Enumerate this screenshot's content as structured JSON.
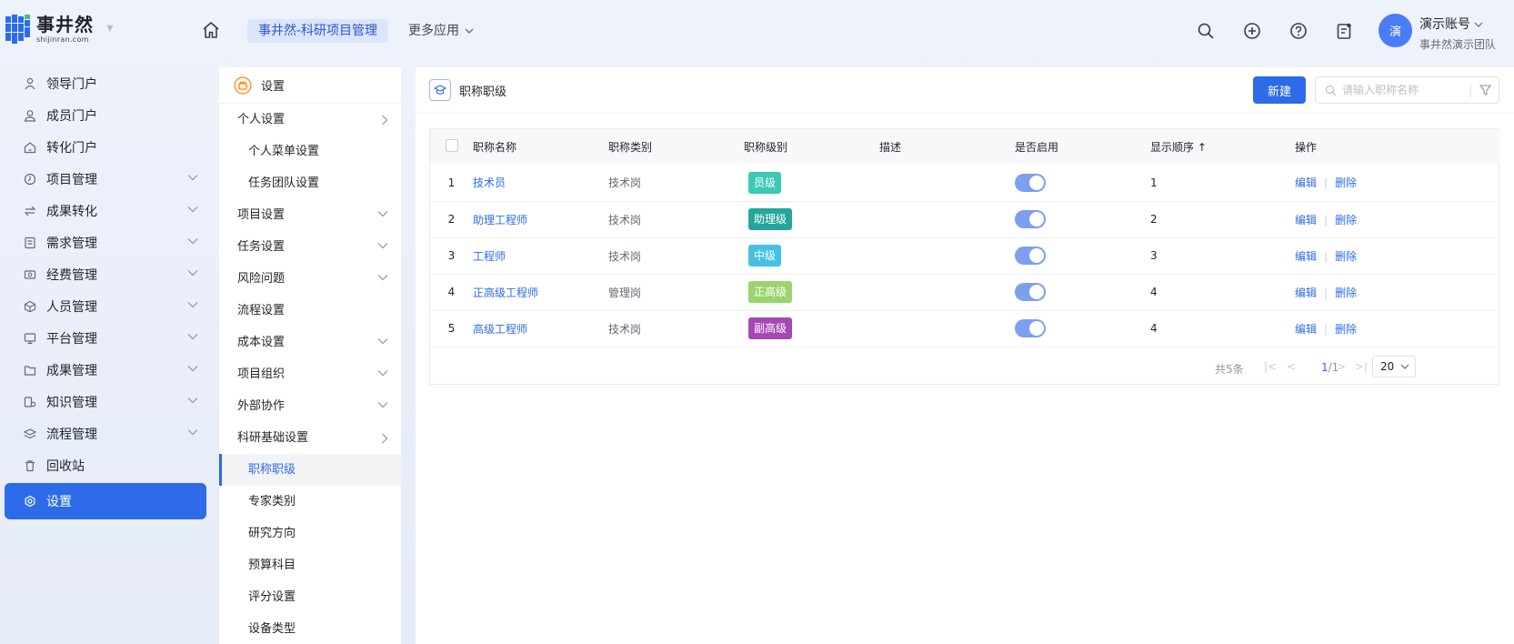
{
  "header": {
    "logo_cn": "事井然",
    "logo_en": "shijinran.com",
    "app_tab": "事井然-科研项目管理",
    "more_apps": "更多应用",
    "avatar_initial": "演",
    "account_name": "演示账号",
    "account_team": "事井然演示团队"
  },
  "leftnav": {
    "items": [
      {
        "label": "领导门户",
        "icon": "person-icon"
      },
      {
        "label": "成员门户",
        "icon": "user-icon"
      },
      {
        "label": "转化门户",
        "icon": "house-icon"
      },
      {
        "label": "项目管理",
        "icon": "clock-icon"
      },
      {
        "label": "成果转化",
        "icon": "transfer-icon"
      },
      {
        "label": "需求管理",
        "icon": "document-icon"
      },
      {
        "label": "经费管理",
        "icon": "money-icon"
      },
      {
        "label": "人员管理",
        "icon": "cube-icon"
      },
      {
        "label": "平台管理",
        "icon": "monitor-icon"
      },
      {
        "label": "成果管理",
        "icon": "folder-icon"
      },
      {
        "label": "知识管理",
        "icon": "knowledge-icon"
      },
      {
        "label": "流程管理",
        "icon": "layers-icon"
      },
      {
        "label": "回收站",
        "icon": "trash-icon"
      },
      {
        "label": "设置",
        "icon": "settings-icon"
      }
    ]
  },
  "subnav": {
    "title": "设置",
    "items": [
      {
        "label": "个人设置"
      },
      {
        "label": "个人菜单设置"
      },
      {
        "label": "任务团队设置"
      },
      {
        "label": "项目设置"
      },
      {
        "label": "任务设置"
      },
      {
        "label": "风险问题"
      },
      {
        "label": "流程设置"
      },
      {
        "label": "成本设置"
      },
      {
        "label": "项目组织"
      },
      {
        "label": "外部协作"
      },
      {
        "label": "科研基础设置"
      },
      {
        "label": "职称职级"
      },
      {
        "label": "专家类别"
      },
      {
        "label": "研究方向"
      },
      {
        "label": "预算科目"
      },
      {
        "label": "评分设置"
      },
      {
        "label": "设备类型"
      }
    ]
  },
  "main": {
    "title": "职称职级",
    "new_button": "新建",
    "search_placeholder": "请输入职称名称",
    "columns": {
      "name": "职称名称",
      "category": "职称类别",
      "level": "职称级别",
      "description": "描述",
      "enabled": "是否启用",
      "order": "显示顺序",
      "sort_arrow": "↑",
      "actions": "操作"
    },
    "rows": [
      {
        "index": "1",
        "name": "技术员",
        "category": "技术岗",
        "level": "员级",
        "level_color": "#3cc8b4",
        "enabled": true,
        "order": "1"
      },
      {
        "index": "2",
        "name": "助理工程师",
        "category": "技术岗",
        "level": "助理级",
        "level_color": "#26a69a",
        "enabled": true,
        "order": "2"
      },
      {
        "index": "3",
        "name": "工程师",
        "category": "技术岗",
        "level": "中级",
        "level_color": "#47c1e3",
        "enabled": true,
        "order": "3"
      },
      {
        "index": "4",
        "name": "正高级工程师",
        "category": "管理岗",
        "level": "正高级",
        "level_color": "#9bd46e",
        "enabled": true,
        "order": "4"
      },
      {
        "index": "5",
        "name": "高级工程师",
        "category": "技术岗",
        "level": "副高级",
        "level_color": "#a548b6",
        "enabled": true,
        "order": "4"
      }
    ],
    "edit_label": "编辑",
    "delete_label": "删除",
    "pager": {
      "total": "共5条",
      "current": "1",
      "pages": "/1",
      "page_size": "20"
    }
  },
  "colors": {
    "accent": "#2d6be8"
  }
}
